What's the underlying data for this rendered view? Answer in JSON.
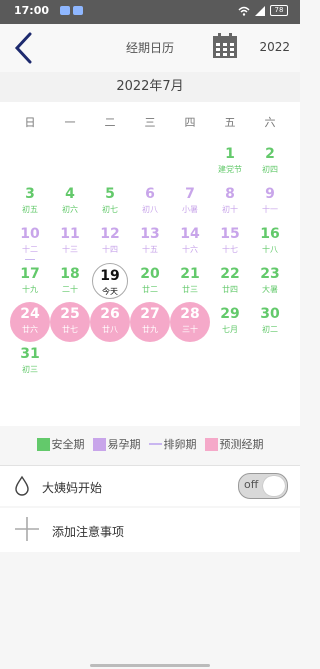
{
  "status_bar": {
    "time": "17:00",
    "battery": "78"
  },
  "header": {
    "title": "经期日历",
    "year": "2022",
    "back_icon": "chevron-left-icon",
    "calendar_icon": "calendar-icon"
  },
  "month_label": "2022年7月",
  "weekdays": [
    "日",
    "一",
    "二",
    "三",
    "四",
    "五",
    "六"
  ],
  "colors": {
    "safe": "#63c96b",
    "pregnancy": "#c8a5ea",
    "ovulation": "#c9b6f0",
    "predicted": "#f5a9c9"
  },
  "days": [
    {
      "num": "1",
      "sub": "建党节",
      "type": "safe"
    },
    {
      "num": "2",
      "sub": "初四",
      "type": "safe"
    },
    {
      "num": "3",
      "sub": "初五",
      "type": "safe"
    },
    {
      "num": "4",
      "sub": "初六",
      "type": "safe"
    },
    {
      "num": "5",
      "sub": "初七",
      "type": "safe"
    },
    {
      "num": "6",
      "sub": "初八",
      "type": "pregnancy"
    },
    {
      "num": "7",
      "sub": "小暑",
      "type": "pregnancy"
    },
    {
      "num": "8",
      "sub": "初十",
      "type": "pregnancy"
    },
    {
      "num": "9",
      "sub": "十一",
      "type": "pregnancy"
    },
    {
      "num": "10",
      "sub": "十二",
      "type": "pregnancy",
      "ovulation": true
    },
    {
      "num": "11",
      "sub": "十三",
      "type": "pregnancy"
    },
    {
      "num": "12",
      "sub": "十四",
      "type": "pregnancy"
    },
    {
      "num": "13",
      "sub": "十五",
      "type": "pregnancy"
    },
    {
      "num": "14",
      "sub": "十六",
      "type": "pregnancy"
    },
    {
      "num": "15",
      "sub": "十七",
      "type": "pregnancy"
    },
    {
      "num": "16",
      "sub": "十八",
      "type": "safe"
    },
    {
      "num": "17",
      "sub": "十九",
      "type": "safe"
    },
    {
      "num": "18",
      "sub": "二十",
      "type": "safe"
    },
    {
      "num": "19",
      "sub": "今天",
      "type": "today"
    },
    {
      "num": "20",
      "sub": "廿二",
      "type": "safe"
    },
    {
      "num": "21",
      "sub": "廿三",
      "type": "safe"
    },
    {
      "num": "22",
      "sub": "廿四",
      "type": "safe"
    },
    {
      "num": "23",
      "sub": "大暑",
      "type": "safe"
    },
    {
      "num": "24",
      "sub": "廿六",
      "type": "predicted"
    },
    {
      "num": "25",
      "sub": "廿七",
      "type": "predicted"
    },
    {
      "num": "26",
      "sub": "廿八",
      "type": "predicted"
    },
    {
      "num": "27",
      "sub": "廿九",
      "type": "predicted"
    },
    {
      "num": "28",
      "sub": "三十",
      "type": "predicted"
    },
    {
      "num": "29",
      "sub": "七月",
      "type": "safe"
    },
    {
      "num": "30",
      "sub": "初二",
      "type": "safe"
    },
    {
      "num": "31",
      "sub": "初三",
      "type": "safe"
    }
  ],
  "legend": {
    "safe": "安全期",
    "pregnancy": "易孕期",
    "ovulation": "排卵期",
    "predicted": "预测经期"
  },
  "period_start": {
    "label": "大姨妈开始",
    "toggle": "off"
  },
  "add_note": {
    "label": "添加注意事项"
  }
}
